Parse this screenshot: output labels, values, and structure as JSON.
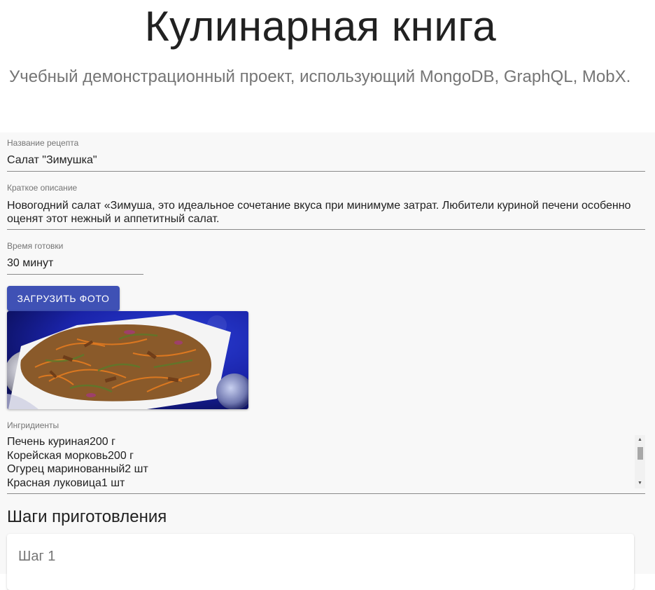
{
  "header": {
    "title": "Кулинарная книга",
    "subtitle": "Учебный демонстрационный проект, использующий MongoDB, GraphQL, MobX."
  },
  "form": {
    "recipe_name": {
      "label": "Название рецепта",
      "value": "Салат \"Зимушка\""
    },
    "description": {
      "label": "Краткое описание",
      "line1": "Новогодний салат «Зимуша, это идеальное сочетание вкуса при минимуме затрат. Любители куриной печени особенно",
      "line2": "оценят этот нежный и аппетитный салат."
    },
    "cook_time": {
      "label": "Время готовки",
      "value": "30 минут"
    },
    "upload_button_label": "ЗАГРУЗИТЬ ФОТО",
    "ingredients": {
      "label": "Ингридиенты",
      "items": [
        "Печень куриная200 г",
        "Корейская морковь200 г",
        "Огурец маринованный2 шт",
        "Красная луковица1 шт"
      ]
    }
  },
  "steps": {
    "title": "Шаги приготовления",
    "items": [
      {
        "title": "Шаг 1"
      }
    ]
  },
  "colors": {
    "accent": "#3f51b5",
    "form_background": "#f8f8f8",
    "label": "#757575"
  },
  "icons": {
    "scroll_up": "triangle-up-icon",
    "scroll_down": "triangle-down-icon"
  }
}
